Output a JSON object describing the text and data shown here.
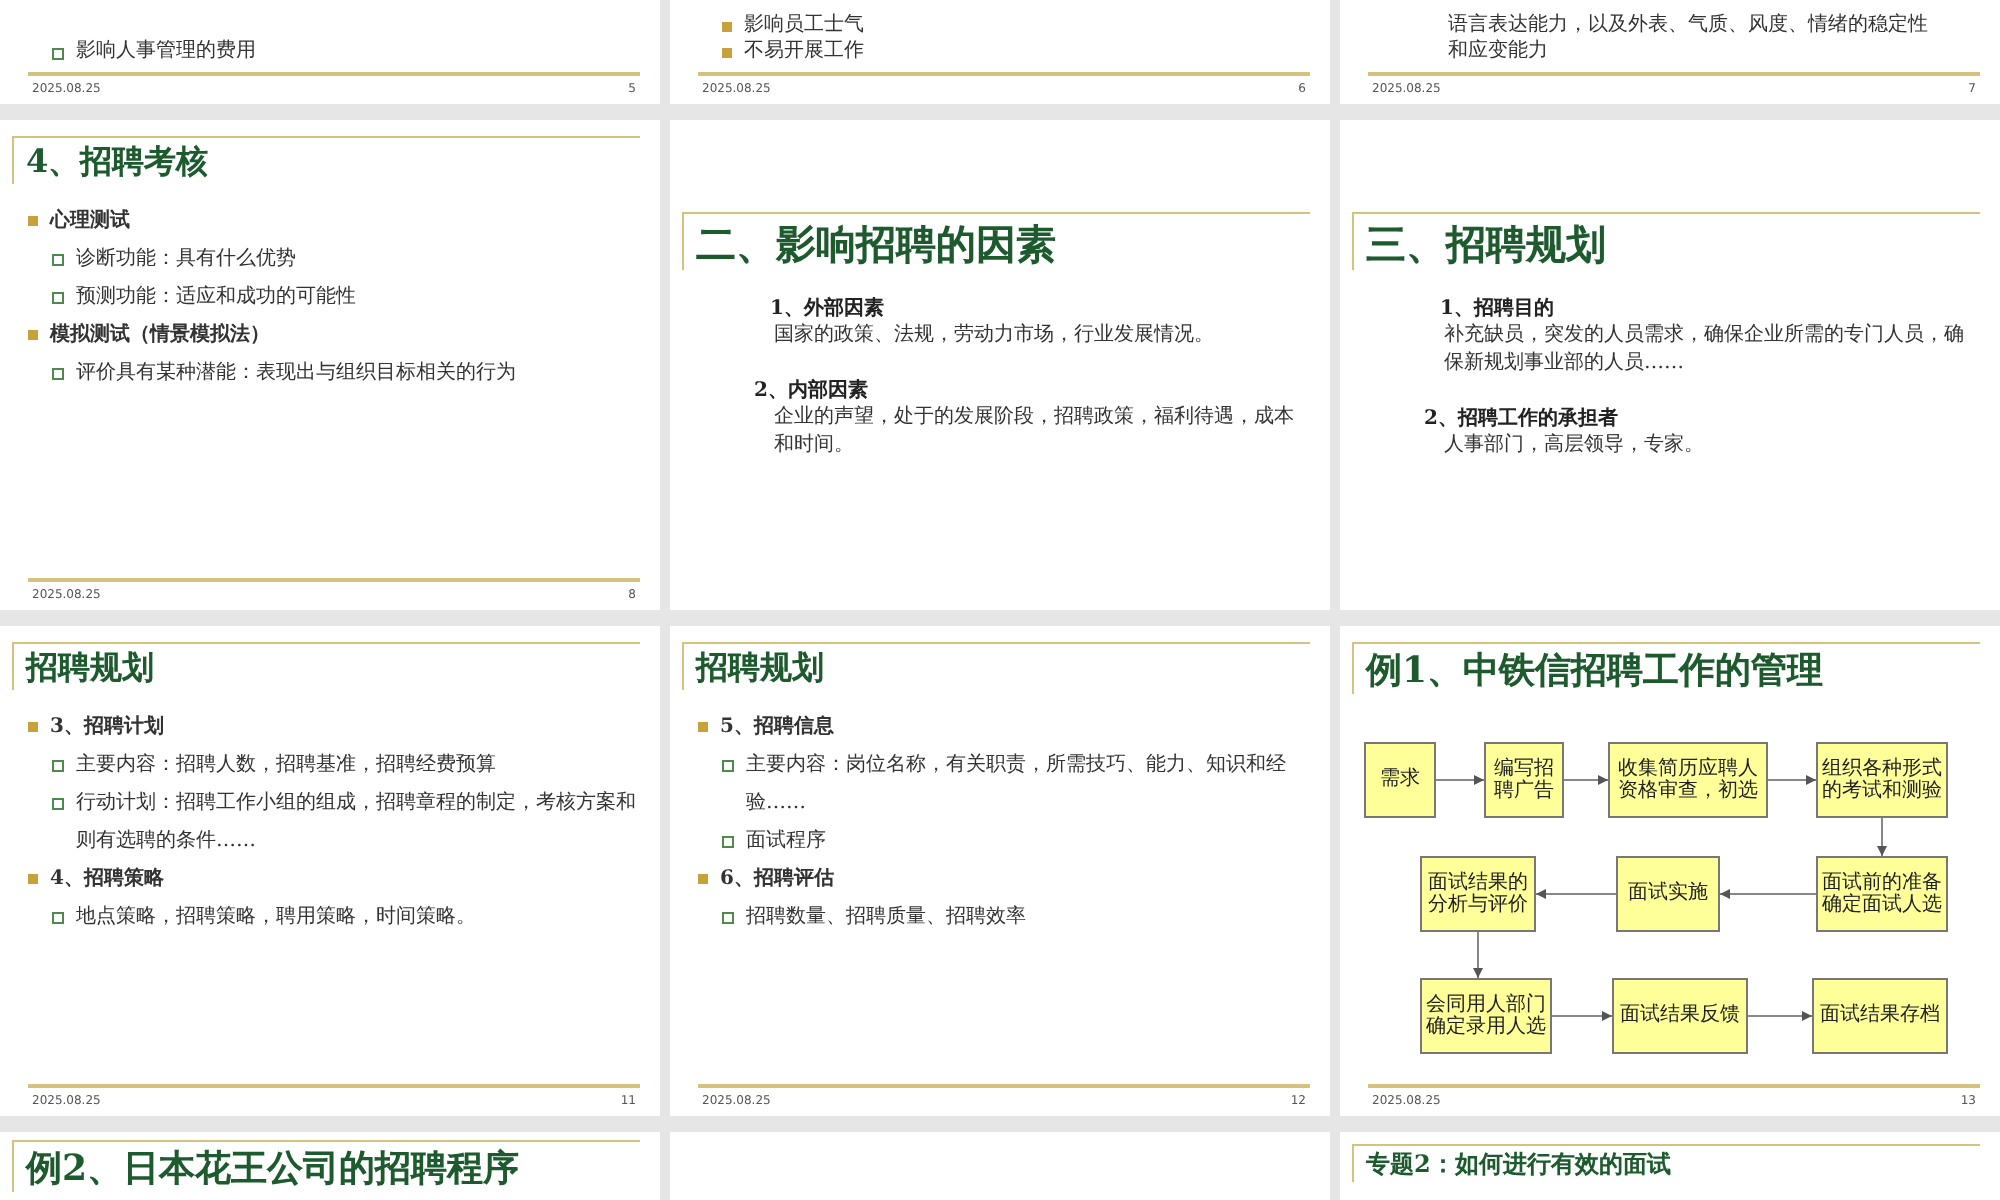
{
  "slides": [
    {
      "kind": "tail",
      "lines": [
        {
          "kind": "hollow",
          "text": "影响人事管理的费用"
        }
      ],
      "date": "2025.08.25",
      "number": "5"
    },
    {
      "kind": "tail",
      "lines": [
        {
          "kind": "square",
          "text": "影响员工士气"
        },
        {
          "kind": "square",
          "text": "不易开展工作"
        }
      ],
      "date": "2025.08.25",
      "number": "6"
    },
    {
      "kind": "tail",
      "lines": [
        {
          "kind": "plain",
          "text": "语言表达能力，以及外表、气质、风度、情绪的稳定性"
        },
        {
          "kind": "plain",
          "text": "和应变能力"
        }
      ],
      "date": "2025.08.25",
      "number": "7"
    },
    {
      "kind": "bullets",
      "title": "4、招聘考核",
      "items": [
        {
          "text": "心理测试",
          "children": [
            {
              "text": "诊断功能：具有什么优势"
            },
            {
              "text": "预测功能：适应和成功的可能性"
            }
          ]
        },
        {
          "text": "模拟测试（情景模拟法）",
          "children": [
            {
              "text": "评价具有某种潜能：表现出与组织目标相关的行为"
            }
          ]
        }
      ],
      "date": "2025.08.25",
      "number": "8"
    },
    {
      "kind": "section",
      "title": "二、影响招聘的因素",
      "paragraphs": [
        {
          "heading": "1、外部因素",
          "body": "国家的政策、法规，劳动力市场，行业发展情况。"
        },
        {
          "heading": "2、内部因素",
          "body": "企业的声望，处于的发展阶段，招聘政策，福利待遇，成本和时间。"
        }
      ]
    },
    {
      "kind": "section",
      "title": "三、招聘规划",
      "paragraphs": [
        {
          "heading": "1、招聘目的",
          "body": "补充缺员，突发的人员需求，确保企业所需的专门人员，确保新规划事业部的人员……"
        },
        {
          "heading": "2、招聘工作的承担者",
          "body": "人事部门，高层领导，专家。"
        }
      ]
    },
    {
      "kind": "bullets",
      "title": "招聘规划",
      "items": [
        {
          "text": "3、招聘计划",
          "children": [
            {
              "text": "主要内容：招聘人数，招聘基准，招聘经费预算"
            },
            {
              "text": "行动计划：招聘工作小组的组成，招聘章程的制定，考核方案和则有选聘的条件……"
            }
          ]
        },
        {
          "text": "4、招聘策略",
          "children": [
            {
              "text": "地点策略，招聘策略，聘用策略，时间策略。"
            }
          ]
        }
      ],
      "date": "2025.08.25",
      "number": "11"
    },
    {
      "kind": "bullets",
      "title": "招聘规划",
      "items": [
        {
          "text": "5、招聘信息",
          "children": [
            {
              "text": "主要内容：岗位名称，有关职责，所需技巧、能力、知识和经验……"
            },
            {
              "text": "面试程序"
            }
          ]
        },
        {
          "text": "6、招聘评估",
          "children": [
            {
              "text": "招聘数量、招聘质量、招聘效率"
            }
          ]
        }
      ],
      "date": "2025.08.25",
      "number": "12"
    },
    {
      "kind": "flowchart",
      "title": "例1、中铁信招聘工作的管理",
      "steps": [
        "需求",
        "编写招聘广告",
        "收集简历应聘人资格审查，初选",
        "组织各种形式的考试和测验",
        "面试结果的分析与评价",
        "面试实施",
        "面试前的准备确定面试人选",
        "会同用人部门确定录用人选",
        "面试结果反馈",
        "面试结果存档"
      ],
      "date": "2025.08.25",
      "number": "13"
    },
    {
      "kind": "header",
      "title": "例2、日本花王公司的招聘程序"
    },
    {
      "kind": "blank"
    },
    {
      "kind": "small-header",
      "title": "专题2：如何进行有效的面试"
    }
  ]
}
